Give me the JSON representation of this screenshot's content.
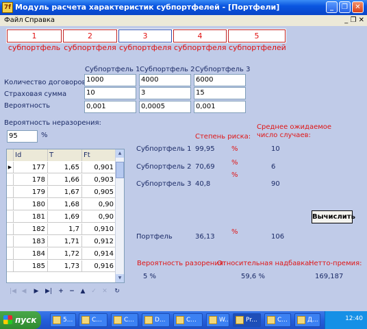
{
  "window": {
    "title": "Модуль расчета характеристик субпортфелей - [Портфели]",
    "app_icon_glyph": "7f",
    "minimize_glyph": "_",
    "restore_glyph": "❐",
    "close_glyph": "✕"
  },
  "menu": {
    "items": [
      "Файл",
      "Справка"
    ],
    "mdi_controls": "_ ❐ ✕"
  },
  "tabs": [
    {
      "label": "1 субпортфель",
      "active": false
    },
    {
      "label": "2 субпортфеля",
      "active": false
    },
    {
      "label": "3 субпортфеля",
      "active": true
    },
    {
      "label": "4 субпортфеля",
      "active": false
    },
    {
      "label": "5 субпортфелей",
      "active": false
    }
  ],
  "params": {
    "columns": [
      "Субпортфель 1",
      "Субпортфель 2",
      "Субпортфель 3"
    ],
    "rows": [
      {
        "label": "Количество договоров",
        "values": [
          "1000",
          "4000",
          "6000"
        ]
      },
      {
        "label": "Страховая сумма",
        "values": [
          "10",
          "3",
          "15"
        ]
      },
      {
        "label": "Вероятность",
        "values": [
          "0,001",
          "0,0005",
          "0,001"
        ]
      }
    ]
  },
  "ruin": {
    "label": "Вероятность неразорения:",
    "value": "95",
    "unit": "%"
  },
  "grid": {
    "columns": [
      "Id",
      "T",
      "Ft"
    ],
    "rows": [
      [
        "177",
        "1,65",
        "0,901"
      ],
      [
        "178",
        "1,66",
        "0,903"
      ],
      [
        "179",
        "1,67",
        "0,905"
      ],
      [
        "180",
        "1,68",
        "0,90"
      ],
      [
        "181",
        "1,69",
        "0,90"
      ],
      [
        "182",
        "1,7",
        "0,910"
      ],
      [
        "183",
        "1,71",
        "0,912"
      ],
      [
        "184",
        "1,72",
        "0,914"
      ],
      [
        "185",
        "1,73",
        "0,916"
      ]
    ],
    "current_row_marker": "▶"
  },
  "navigator": [
    "|◀",
    "◀",
    "▶",
    "▶|",
    "+",
    "−",
    "▲",
    "✓",
    "✕",
    "↻"
  ],
  "results": {
    "risk_header": "Степень риска:",
    "expected_header_1": "Среднее ожидаемое",
    "expected_header_2": "число случаев:",
    "rows": [
      {
        "label": "Субпортфель 1",
        "risk": "99,95",
        "pct": "%",
        "cases": "10"
      },
      {
        "label": "Субпортфель 2",
        "risk": "70,69",
        "pct": "%",
        "cases": "6"
      },
      {
        "label": "Субпортфель 3",
        "risk": "40,8",
        "pct": "%",
        "cases": "90"
      }
    ],
    "portfolio": {
      "label": "Портфель",
      "risk": "36,13",
      "pct": "%",
      "cases": "106"
    }
  },
  "calc_button": "Вычислить",
  "summary": {
    "ruin_label": "Вероятность разорения:",
    "ruin_value": "5 %",
    "markup_label": "Относительная надбавка:",
    "markup_value": "59,6 %",
    "premium_label": "Нетто-премия:",
    "premium_value": "169,187"
  },
  "taskbar": {
    "start_label": "пуск",
    "tasks": [
      "5...",
      "C...",
      "C...",
      "D...",
      "C...",
      "W...",
      "Pr...",
      "C...",
      "Д..."
    ],
    "clock": "12:40"
  }
}
